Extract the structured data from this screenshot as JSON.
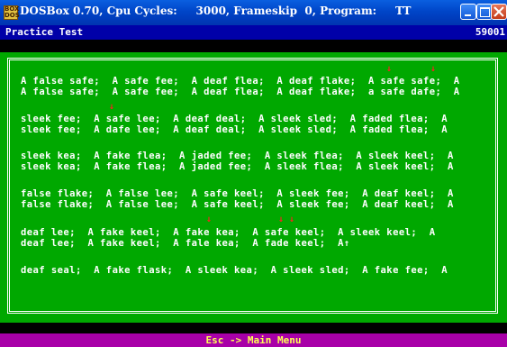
{
  "window": {
    "title": "DOSBox 0.70, Cpu Cycles:     3000, Frameskip  0, Program:     TT",
    "icon_text_top": "BOX",
    "icon_text_bottom": "DOS"
  },
  "header": {
    "title": "Practice Test",
    "counter": "59001"
  },
  "lines": [
    "A false safe;  A safe fee;  A deaf flea;  A deaf flake;  A safe safe;  A",
    "A false safe;  A safe fee;  A deaf flea;  A deaf flake;  a safe dafe;  A",
    "sleek fee;  A safe lee;  A deaf deal;  A sleek sled;  A faded flea;  A",
    "sleek fee;  A dafe lee;  A deaf deal;  A sleek sled;  A faded flea;  A",
    "sleek kea;  A fake flea;  A jaded fee;  A sleek flea;  A sleek keel;  A",
    "sleek kea;  A fake flea;  A jaded fee;  A sleek flea;  A sleek keel;  A",
    "false flake;  A false lee;  A safe keel;  A sleek fee;  A deaf keel;  A",
    "false flake;  A false lee;  A safe keel;  A sleek fee;  A deaf keel;  A",
    "deaf lee;  A fake keel;  A fake kea;  A safe keel;  A sleek keel;  A",
    "deaf lee;  A fake keel;  A fale kea;  A fade keel;  A↑",
    "deaf seal;  A fake flask;  A sleek kea;  A sleek sled;  A fake fee;  A"
  ],
  "error_marker": "↓",
  "footer": {
    "menu": "Esc -> Main Menu"
  },
  "colors": {
    "background": "#00a800",
    "text": "#ffffff",
    "error_marker": "#ff2020",
    "header_bg": "#0000a8",
    "menu_bg": "#a800a8",
    "menu_text": "#ffff55"
  }
}
